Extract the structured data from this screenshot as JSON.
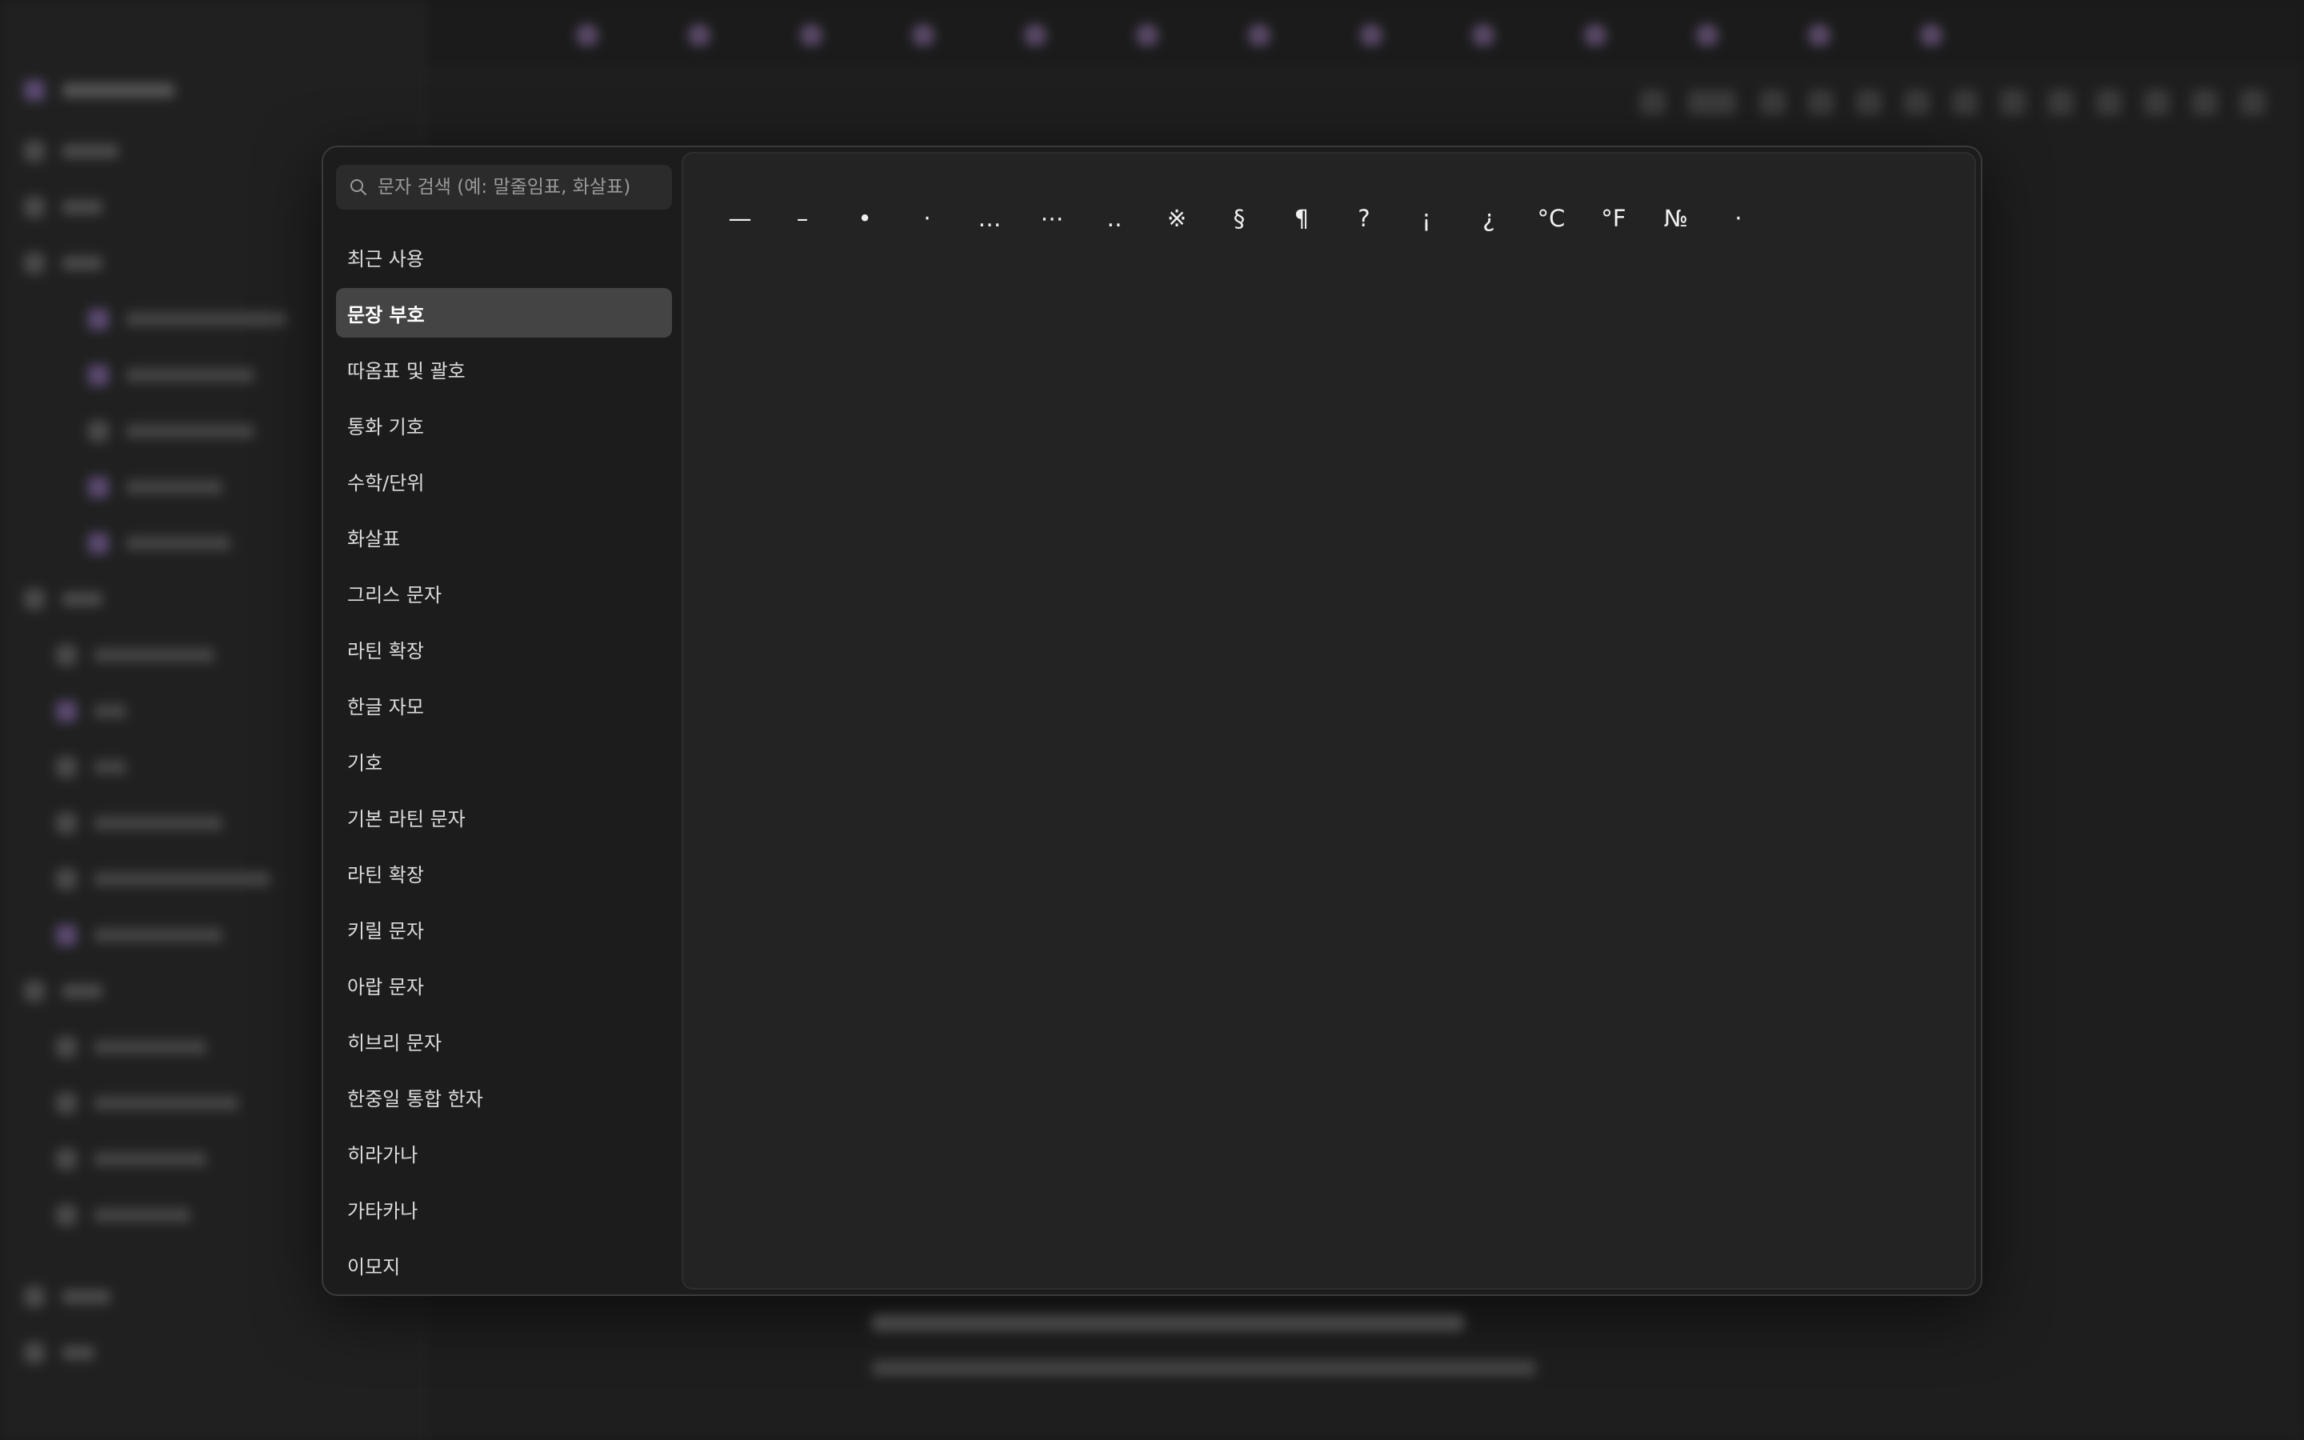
{
  "search": {
    "placeholder": "문자 검색 (예: 말줄임표, 화살표)",
    "value": ""
  },
  "categories": [
    {
      "label": "최근 사용",
      "selected": false
    },
    {
      "label": "문장 부호",
      "selected": true
    },
    {
      "label": "따옴표 및 괄호",
      "selected": false
    },
    {
      "label": "통화 기호",
      "selected": false
    },
    {
      "label": "수학/단위",
      "selected": false
    },
    {
      "label": "화살표",
      "selected": false
    },
    {
      "label": "그리스 문자",
      "selected": false
    },
    {
      "label": "라틴 확장",
      "selected": false
    },
    {
      "label": "한글 자모",
      "selected": false
    },
    {
      "label": "기호",
      "selected": false
    },
    {
      "label": "기본 라틴 문자",
      "selected": false
    },
    {
      "label": "라틴 확장",
      "selected": false
    },
    {
      "label": "키릴 문자",
      "selected": false
    },
    {
      "label": "아랍 문자",
      "selected": false
    },
    {
      "label": "히브리 문자",
      "selected": false
    },
    {
      "label": "한중일 통합 한자",
      "selected": false
    },
    {
      "label": "히라가나",
      "selected": false
    },
    {
      "label": "가타카나",
      "selected": false
    },
    {
      "label": "이모지",
      "selected": false
    }
  ],
  "characters": [
    "—",
    "–",
    "•",
    "·",
    "…",
    "⋯",
    "‥",
    "※",
    "§",
    "¶",
    "?",
    "¡",
    "¿",
    "°C",
    "°F",
    "№",
    "·"
  ],
  "colors": {
    "dialog_bg": "#1c1c1c",
    "panel_bg": "#232323",
    "selected_bg": "#444444",
    "text": "#dcdcdc"
  },
  "icons": {
    "search": "search-icon"
  }
}
